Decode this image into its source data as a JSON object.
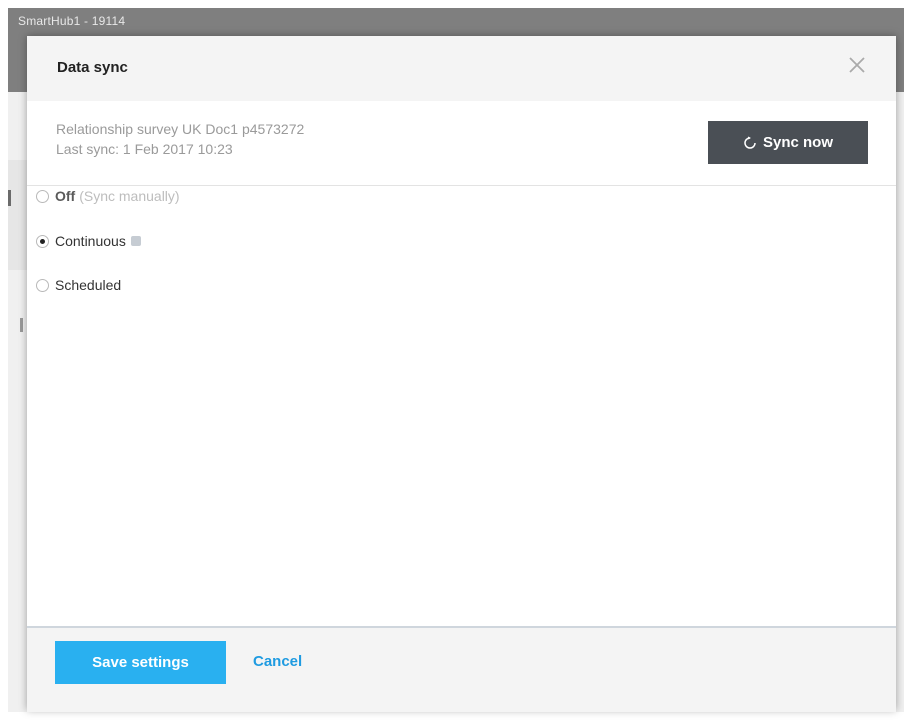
{
  "background": {
    "window_title": "SmartHub1 - 19114"
  },
  "dialog": {
    "title": "Data sync",
    "close_icon": "close-icon",
    "document_name": "Relationship survey UK Doc1 p4573272",
    "last_sync": "Last sync: 1 Feb 2017 10:23",
    "sync_button_label": "Sync now",
    "sync_icon": "refresh-icon",
    "options": {
      "off": {
        "label": "Off",
        "hint": "(Sync manually)",
        "selected": false,
        "disabled": true
      },
      "continuous": {
        "label": "Continuous",
        "selected": true,
        "help_icon": "help-icon"
      },
      "scheduled": {
        "label": "Scheduled",
        "selected": false
      }
    },
    "footer": {
      "save_label": "Save settings",
      "cancel_label": "Cancel"
    }
  },
  "colors": {
    "primary_button": "#29b0f0",
    "secondary_button": "#4a4f55",
    "link": "#1f9be1",
    "header_bg": "#7f7f7f"
  }
}
